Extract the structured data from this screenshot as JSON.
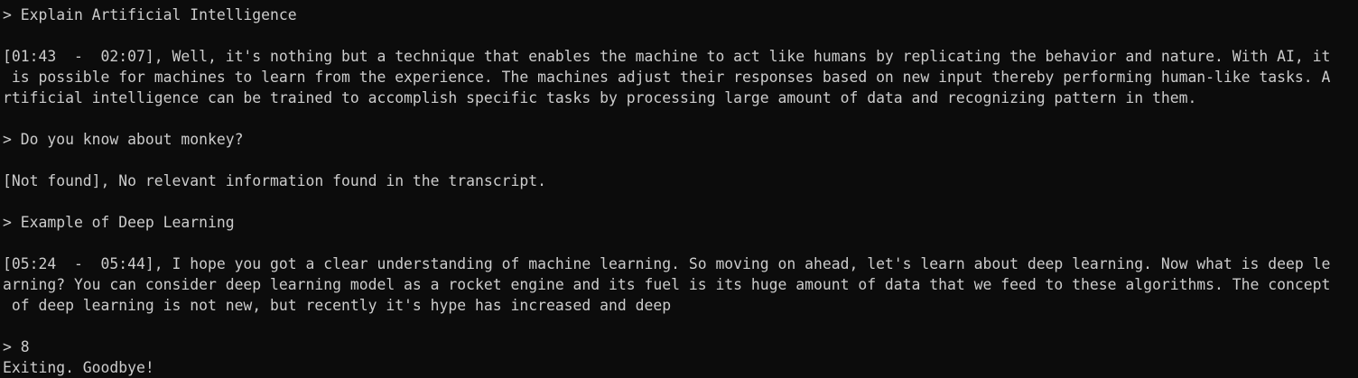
{
  "terminal": {
    "lines": [
      "> Explain Artificial Intelligence",
      "",
      "[01:43  -  02:07], Well, it's nothing but a technique that enables the machine to act like humans by replicating the behavior and nature. With AI, it",
      " is possible for machines to learn from the experience. The machines adjust their responses based on new input thereby performing human-like tasks. A",
      "rtificial intelligence can be trained to accomplish specific tasks by processing large amount of data and recognizing pattern in them.",
      "",
      "> Do you know about monkey?",
      "",
      "[Not found], No relevant information found in the transcript.",
      "",
      "> Example of Deep Learning",
      "",
      "[05:24  -  05:44], I hope you got a clear understanding of machine learning. So moving on ahead, let's learn about deep learning. Now what is deep le",
      "arning? You can consider deep learning model as a rocket engine and its fuel is its huge amount of data that we feed to these algorithms. The concept",
      " of deep learning is not new, but recently it's hype has increased and deep",
      "",
      "> 8",
      "Exiting. Goodbye!"
    ]
  },
  "colors": {
    "background": "#0c0c0c",
    "text": "#cccccc"
  }
}
